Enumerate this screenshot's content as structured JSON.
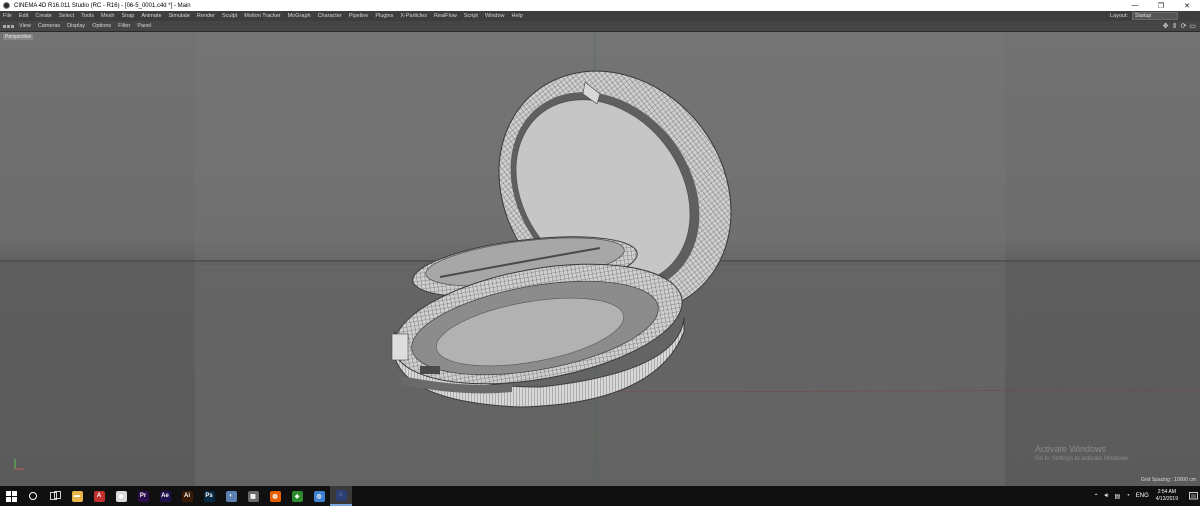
{
  "window": {
    "title": "CINEMA 4D R16.011 Studio (RC - R16) - [06-5_0001.c4d *] - Main",
    "buttons": {
      "minimize": "—",
      "maximize": "❐",
      "close": "✕"
    }
  },
  "menubar": {
    "items": [
      "File",
      "Edit",
      "Create",
      "Select",
      "Tools",
      "Mesh",
      "Snap",
      "Animate",
      "Simulate",
      "Render",
      "Sculpt",
      "Motion Tracker",
      "MoGraph",
      "Character",
      "Pipeline",
      "Plugins",
      "X-Particles",
      "RealFlow",
      "Script",
      "Window",
      "Help"
    ],
    "layout_label": "Layout:",
    "layout_value": "Startup"
  },
  "viewport_menu": {
    "items": [
      "View",
      "Cameras",
      "Display",
      "Options",
      "Filter",
      "Panel"
    ]
  },
  "viewport": {
    "name": "Perspective",
    "grid_spacing": "Grid Spacing : 10000 cm",
    "watermark_title": "Activate Windows",
    "watermark_sub": "Go to Settings to activate Windows."
  },
  "taskbar": {
    "apps": [
      {
        "name": "file-explorer-app",
        "glyph": "▬",
        "color": "#e8b44a"
      },
      {
        "name": "autocad-app",
        "glyph": "A",
        "color": "#c0302f"
      },
      {
        "name": "chrome-app",
        "glyph": "◉",
        "color": "#d9d9d9"
      },
      {
        "name": "premiere-app",
        "glyph": "Pr",
        "color": "#2a0d4a"
      },
      {
        "name": "after-effects-app",
        "glyph": "Ae",
        "color": "#1f0f4a"
      },
      {
        "name": "illustrator-app",
        "glyph": "Ai",
        "color": "#3a1a05"
      },
      {
        "name": "photoshop-app",
        "glyph": "Ps",
        "color": "#062a44"
      },
      {
        "name": "media-app",
        "glyph": "◐",
        "color": "#5a7fb0"
      },
      {
        "name": "calculator-app",
        "glyph": "▦",
        "color": "#6a6a6a"
      },
      {
        "name": "firefox-app",
        "glyph": "◍",
        "color": "#e66000"
      },
      {
        "name": "xbox-app",
        "glyph": "◈",
        "color": "#2d8a2d"
      },
      {
        "name": "browser-app",
        "glyph": "◎",
        "color": "#3d7fd0"
      },
      {
        "name": "cinema4d-app",
        "glyph": "◌",
        "color": "#2c3e73"
      }
    ],
    "active_index": 12,
    "tray": {
      "language": "ENG",
      "time": "2:54 AM",
      "date": "4/13/2019"
    }
  }
}
